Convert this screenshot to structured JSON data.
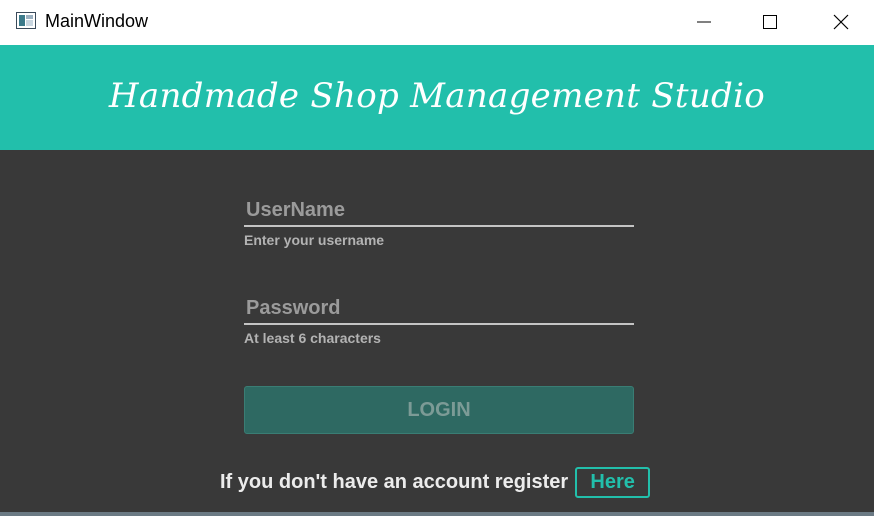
{
  "window": {
    "title": "MainWindow",
    "icons": {
      "app": "app-window-icon",
      "minimize": "minimize-icon",
      "maximize": "maximize-icon",
      "close": "close-icon"
    }
  },
  "header": {
    "title": "Handmade Shop Management Studio",
    "color": "#22bfab"
  },
  "form": {
    "username": {
      "placeholder": "UserName",
      "value": "",
      "hint": "Enter your username"
    },
    "password": {
      "placeholder": "Password",
      "value": "",
      "hint": "At least 6 characters"
    },
    "login_label": "LOGIN"
  },
  "register": {
    "text": "If you don't have an account register",
    "link_label": "Here"
  },
  "colors": {
    "background": "#393939",
    "accent": "#22bfab",
    "login_button": "#2e6962"
  }
}
